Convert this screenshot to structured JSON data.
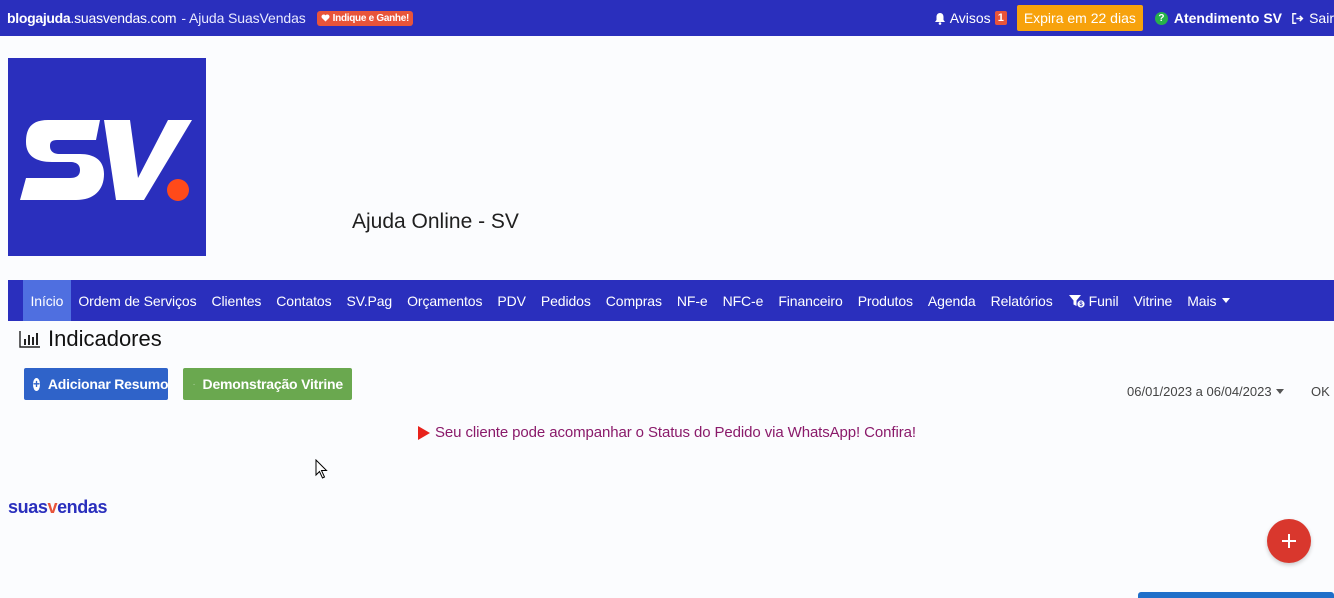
{
  "topbar": {
    "site_bold": "blogajuda",
    "site_rest": ".suasvendas.com",
    "site_title": " - Ajuda SuasVendas",
    "indique_label": "Indique e Ganhe!",
    "avisos_label": "Avisos",
    "avisos_count": "1",
    "expira_label": "Expira em 22 dias",
    "atendimento_label": "Atendimento SV",
    "sair_label": "Sair"
  },
  "header": {
    "help_title": "Ajuda Online - SV"
  },
  "nav": {
    "items": [
      {
        "label": "Início"
      },
      {
        "label": "Ordem de Serviços"
      },
      {
        "label": "Clientes"
      },
      {
        "label": "Contatos"
      },
      {
        "label": "SV.Pag"
      },
      {
        "label": "Orçamentos"
      },
      {
        "label": "PDV"
      },
      {
        "label": "Pedidos"
      },
      {
        "label": "Compras"
      },
      {
        "label": "NF-e"
      },
      {
        "label": "NFC-e"
      },
      {
        "label": "Financeiro"
      },
      {
        "label": "Produtos"
      },
      {
        "label": "Agenda"
      },
      {
        "label": "Relatórios"
      },
      {
        "label": "Funil"
      },
      {
        "label": "Vitrine"
      },
      {
        "label": "Mais"
      }
    ]
  },
  "main": {
    "section_title": "Indicadores",
    "add_button_label": "Adicionar Resumo",
    "demo_button_label": "Demonstração Vitrine",
    "date_range": "06/01/2023 a 06/04/2023",
    "ok_label": "OK",
    "whatsapp_message": "Seu cliente pode acompanhar o Status do Pedido via WhatsApp! Confira!"
  },
  "footer": {
    "brand_pre": "suas",
    "brand_v": "v",
    "brand_post": "endas"
  },
  "colors": {
    "primary_blue": "#2a2fbd",
    "active_nav": "#4f6fe0",
    "expira_orange": "#f7a20c",
    "fab_red": "#d9372d",
    "demo_green": "#6aa84f",
    "add_blue": "#2f63c9"
  },
  "icons": [
    "heart-icon",
    "bell-icon",
    "help-circle-icon",
    "logout-icon",
    "chart-icon",
    "plus-circle-icon",
    "paper-plane-icon",
    "funnel-icon",
    "play-icon",
    "plus-icon"
  ]
}
